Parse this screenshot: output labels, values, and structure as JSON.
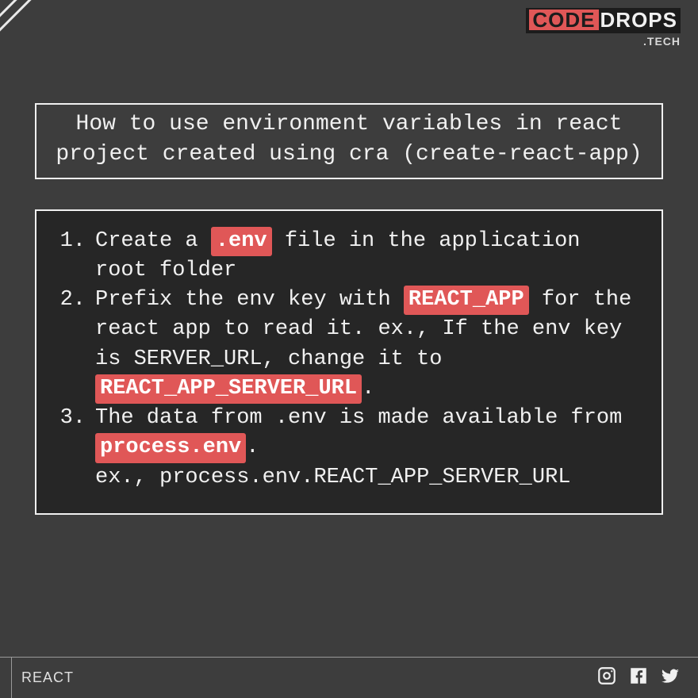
{
  "brand": {
    "part1": "CODE",
    "part2": "DROPS",
    "sub": ".TECH"
  },
  "title": "How to use environment variables in react project created using cra (create-react-app)",
  "steps": [
    {
      "num": "1.",
      "t1": "Create a ",
      "h1": ".env",
      "t2": " file in the application root folder"
    },
    {
      "num": "2.",
      "t1": "Prefix the env key with ",
      "h1": "REACT_APP",
      "t2": " for the react app to read it. ex., If the env key is SERVER_URL, change it to ",
      "h2": "REACT_APP_SERVER_URL",
      "t3": "."
    },
    {
      "num": "3.",
      "t1": "The data from .env is made available from ",
      "h1": "process.env",
      "t2": ".",
      "sub": "ex., process.env.REACT_APP_SERVER_URL"
    }
  ],
  "footer": {
    "tag": "REACT"
  }
}
